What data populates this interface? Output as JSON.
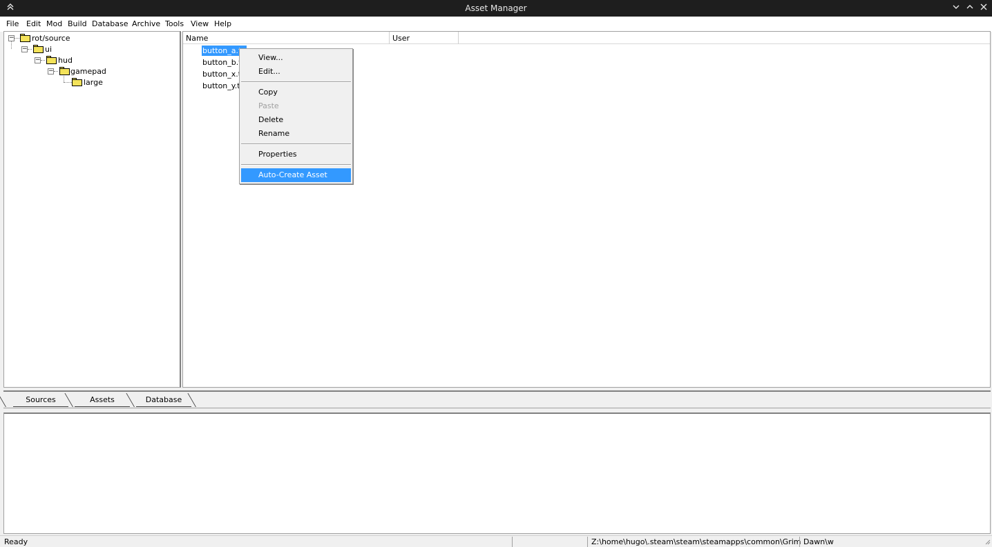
{
  "window": {
    "title": "Asset Manager",
    "icons": [
      "collapse-up-icon",
      "minimize-icon",
      "maximize-icon",
      "close-icon"
    ]
  },
  "menubar": {
    "items": [
      {
        "label": "File"
      },
      {
        "label": "Edit"
      },
      {
        "label": "Mod"
      },
      {
        "label": "Build"
      },
      {
        "label": "Database"
      },
      {
        "label": "Archive"
      },
      {
        "label": "Tools"
      },
      {
        "label": "View"
      },
      {
        "label": "Help"
      }
    ]
  },
  "tree": {
    "nodes": [
      {
        "label": "rot/source",
        "expanded": true
      },
      {
        "label": "ui",
        "expanded": true
      },
      {
        "label": "hud",
        "expanded": true
      },
      {
        "label": "gamepad",
        "expanded": true
      },
      {
        "label": "large",
        "expanded": false
      }
    ]
  },
  "list": {
    "columns": [
      "Name",
      "User"
    ],
    "rows": [
      {
        "name": "button_a.te",
        "selected": true
      },
      {
        "name": "button_b.te",
        "selected": false
      },
      {
        "name": "button_x.te",
        "selected": false
      },
      {
        "name": "button_y.te",
        "selected": false
      }
    ]
  },
  "context_menu": {
    "items": [
      {
        "label": "View...",
        "disabled": false
      },
      {
        "label": "Edit...",
        "disabled": false
      },
      {
        "label": "Copy",
        "disabled": false
      },
      {
        "label": "Paste",
        "disabled": true
      },
      {
        "label": "Delete",
        "disabled": false
      },
      {
        "label": "Rename",
        "disabled": false
      },
      {
        "label": "Properties",
        "disabled": false
      },
      {
        "label": "Auto-Create Asset",
        "disabled": false,
        "highlighted": true
      }
    ]
  },
  "tabs": [
    {
      "label": "Sources",
      "active": true
    },
    {
      "label": "Assets",
      "active": false
    },
    {
      "label": "Database",
      "active": false
    }
  ],
  "status": {
    "left": "Ready",
    "path": "Z:\\home\\hugo\\.steam\\steam\\steamapps\\common\\Grim Dawn\\w"
  },
  "colors": {
    "titlebar": "#1e1e1e",
    "selection": "#3399ff",
    "folder": "#f4e35a"
  }
}
